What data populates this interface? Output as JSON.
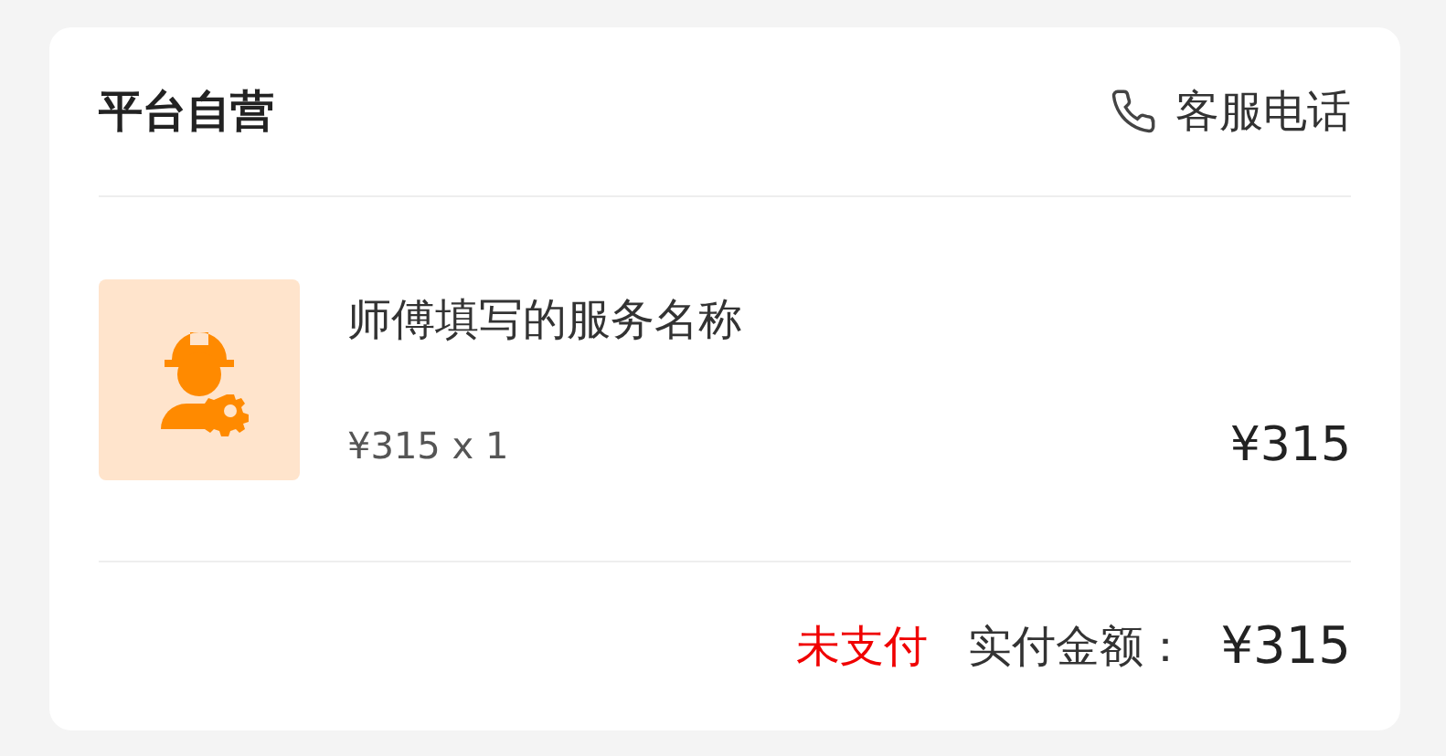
{
  "shop": {
    "name": "平台自营",
    "service_label": "客服电话"
  },
  "item": {
    "image": {
      "kind": "worker"
    },
    "title": "师傅填写的服务名称",
    "unit_price": "¥315 x 1",
    "price": "¥315"
  },
  "footer": {
    "status": {
      "text": "未支付",
      "kind": "unpaid"
    },
    "paid_label": "实付金额：",
    "paid_amount": "¥315"
  }
}
